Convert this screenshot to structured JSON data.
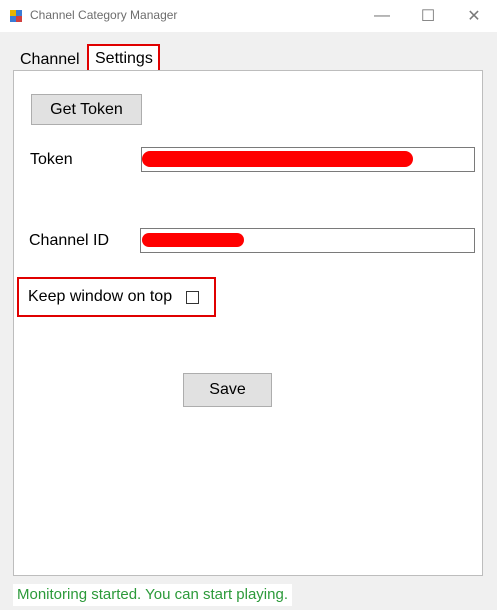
{
  "window": {
    "title": "Channel Category Manager",
    "minimize_glyph": "—",
    "maximize_glyph": "☐",
    "close_glyph": "✕"
  },
  "tabs": [
    {
      "label": "Channel",
      "active": false
    },
    {
      "label": "Settings",
      "active": true
    }
  ],
  "settings": {
    "get_token_label": "Get Token",
    "token_label": "Token",
    "token_value": "",
    "channel_id_label": "Channel ID",
    "channel_id_value": "",
    "keep_on_top_label": "Keep window on top",
    "keep_on_top_checked": false,
    "save_label": "Save"
  },
  "status": {
    "text": "Monitoring started. You can start playing."
  },
  "colors": {
    "highlight": "#e00000",
    "redaction": "#ff0000",
    "status_text": "#2c9a3a"
  }
}
